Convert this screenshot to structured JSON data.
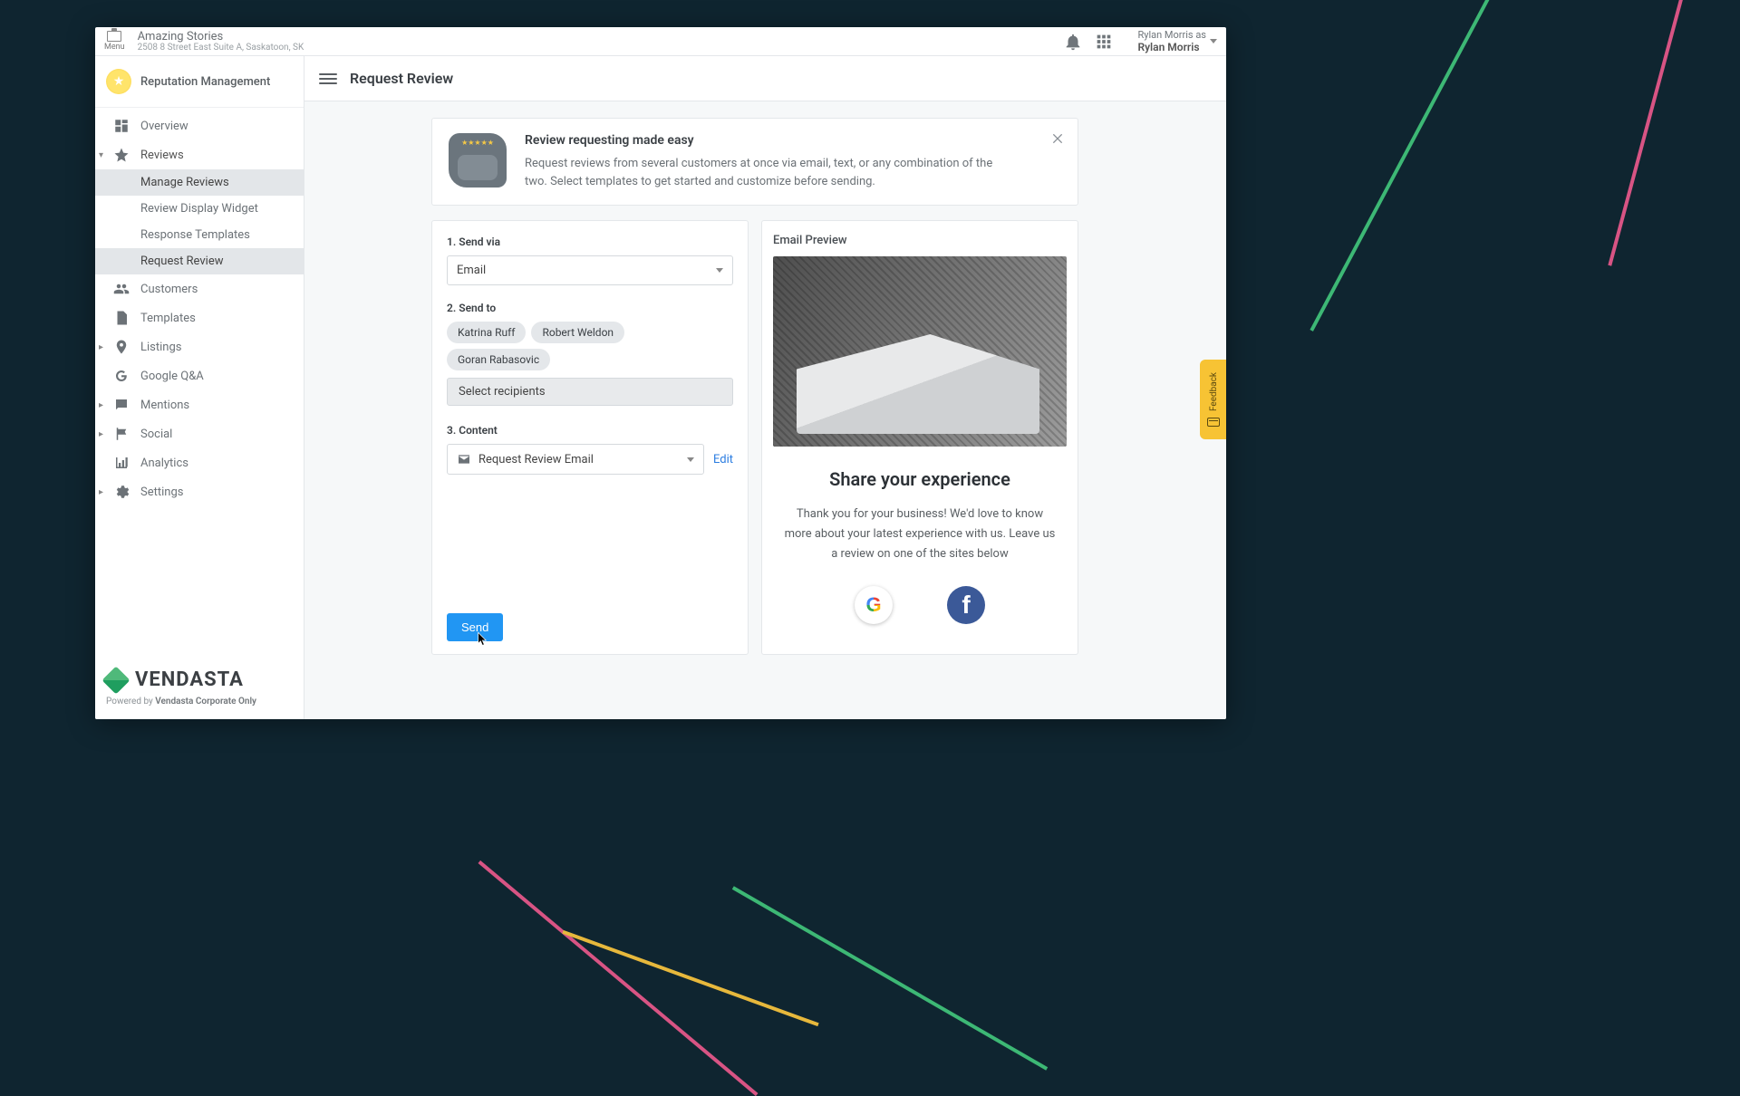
{
  "topbar": {
    "menu_label": "Menu",
    "business_name": "Amazing Stories",
    "business_address": "2508 8 Street East Suite A, Saskatoon, SK",
    "user_as_label": "Rylan Morris as",
    "user_name": "Rylan Morris"
  },
  "sidebar": {
    "product_title": "Reputation Management",
    "items": {
      "overview": "Overview",
      "reviews": "Reviews",
      "reviews_children": {
        "manage": "Manage Reviews",
        "widget": "Review Display Widget",
        "response_templates": "Response Templates",
        "request_review": "Request Review"
      },
      "customers": "Customers",
      "templates": "Templates",
      "listings": "Listings",
      "google_qa": "Google Q&A",
      "mentions": "Mentions",
      "social": "Social",
      "analytics": "Analytics",
      "settings": "Settings"
    },
    "footer_brand": "VENDASTA",
    "footer_powered": "Powered by ",
    "footer_company": "Vendasta Corporate Only"
  },
  "main": {
    "page_title": "Request Review",
    "intro_title": "Review requesting made easy",
    "intro_body": "Request reviews from several customers at once via email, text, or any combination of the two. Select templates to get started and customize before sending.",
    "step1_label": "1. Send via",
    "send_via_value": "Email",
    "step2_label": "2. Send to",
    "recipients": [
      "Katrina Ruff",
      "Robert Weldon",
      "Goran Rabasovic"
    ],
    "select_recipients_label": "Select recipients",
    "step3_label": "3. Content",
    "content_template_value": "Request Review Email",
    "edit_label": "Edit",
    "send_label": "Send"
  },
  "preview": {
    "header": "Email Preview",
    "headline": "Share your experience",
    "body": "Thank you for your business! We'd love to know more about your latest experience with us. Leave us a review on one of the sites below",
    "google_label": "G",
    "facebook_label": "f"
  },
  "feedback_tab": "Feedback"
}
